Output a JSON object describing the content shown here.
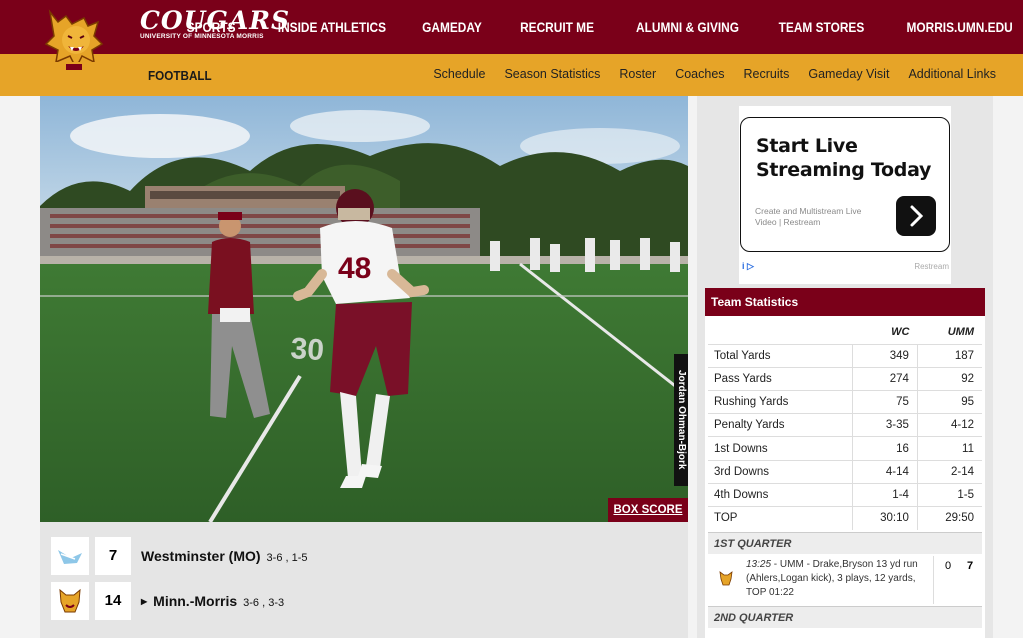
{
  "header": {
    "brand_name": "COUGARS",
    "brand_sub": "UNIVERSITY OF MINNESOTA MORRIS",
    "nav": [
      "SPORTS",
      "INSIDE ATHLETICS",
      "GAMEDAY",
      "RECRUIT ME",
      "ALUMNI & GIVING",
      "TEAM STORES",
      "MORRIS.UMN.EDU"
    ]
  },
  "subnav": {
    "sport": "FOOTBALL",
    "links": [
      "Schedule",
      "Season Statistics",
      "Roster",
      "Coaches",
      "Recruits",
      "Gameday Visit",
      "Additional Links"
    ]
  },
  "photo": {
    "credit": "Jordan Ohman-Bjork",
    "jersey": "48",
    "yard_marker": "30"
  },
  "box_score_label": "BOX SCORE",
  "scoreboard": [
    {
      "points": "7",
      "team": "Westminster (MO)",
      "record": "3-6 , 1-5",
      "winner": false
    },
    {
      "points": "14",
      "team": "Minn.-Morris",
      "record": "3-6 , 3-3",
      "winner": true
    }
  ],
  "ad": {
    "title_line1": "Start Live",
    "title_line2": "Streaming Today",
    "desc_line1": "Create and Multistream Live",
    "desc_line2": "Video | Restream",
    "info": "i ▷",
    "brand": "Restream"
  },
  "team_stats": {
    "title": "Team Statistics",
    "col1": "WC",
    "col2": "UMM",
    "rows": [
      {
        "label": "Total Yards",
        "wc": "349",
        "umm": "187"
      },
      {
        "label": "Pass Yards",
        "wc": "274",
        "umm": "92"
      },
      {
        "label": "Rushing Yards",
        "wc": "75",
        "umm": "95"
      },
      {
        "label": "Penalty Yards",
        "wc": "3-35",
        "umm": "4-12"
      },
      {
        "label": "1st Downs",
        "wc": "16",
        "umm": "11"
      },
      {
        "label": "3rd Downs",
        "wc": "4-14",
        "umm": "2-14"
      },
      {
        "label": "4th Downs",
        "wc": "1-4",
        "umm": "1-5"
      },
      {
        "label": "TOP",
        "wc": "30:10",
        "umm": "29:50"
      }
    ]
  },
  "quarters": {
    "q1": "1ST QUARTER",
    "q2": "2ND QUARTER",
    "play": {
      "time": "13:25",
      "text": " - UMM - Drake,Bryson 13 yd run (Ahlers,Logan kick), 3 plays, 12 yards, TOP 01:22",
      "score_wc": "0",
      "score_umm": "7"
    }
  },
  "colors": {
    "maroon": "#7a0019",
    "gold": "#e6a428"
  }
}
